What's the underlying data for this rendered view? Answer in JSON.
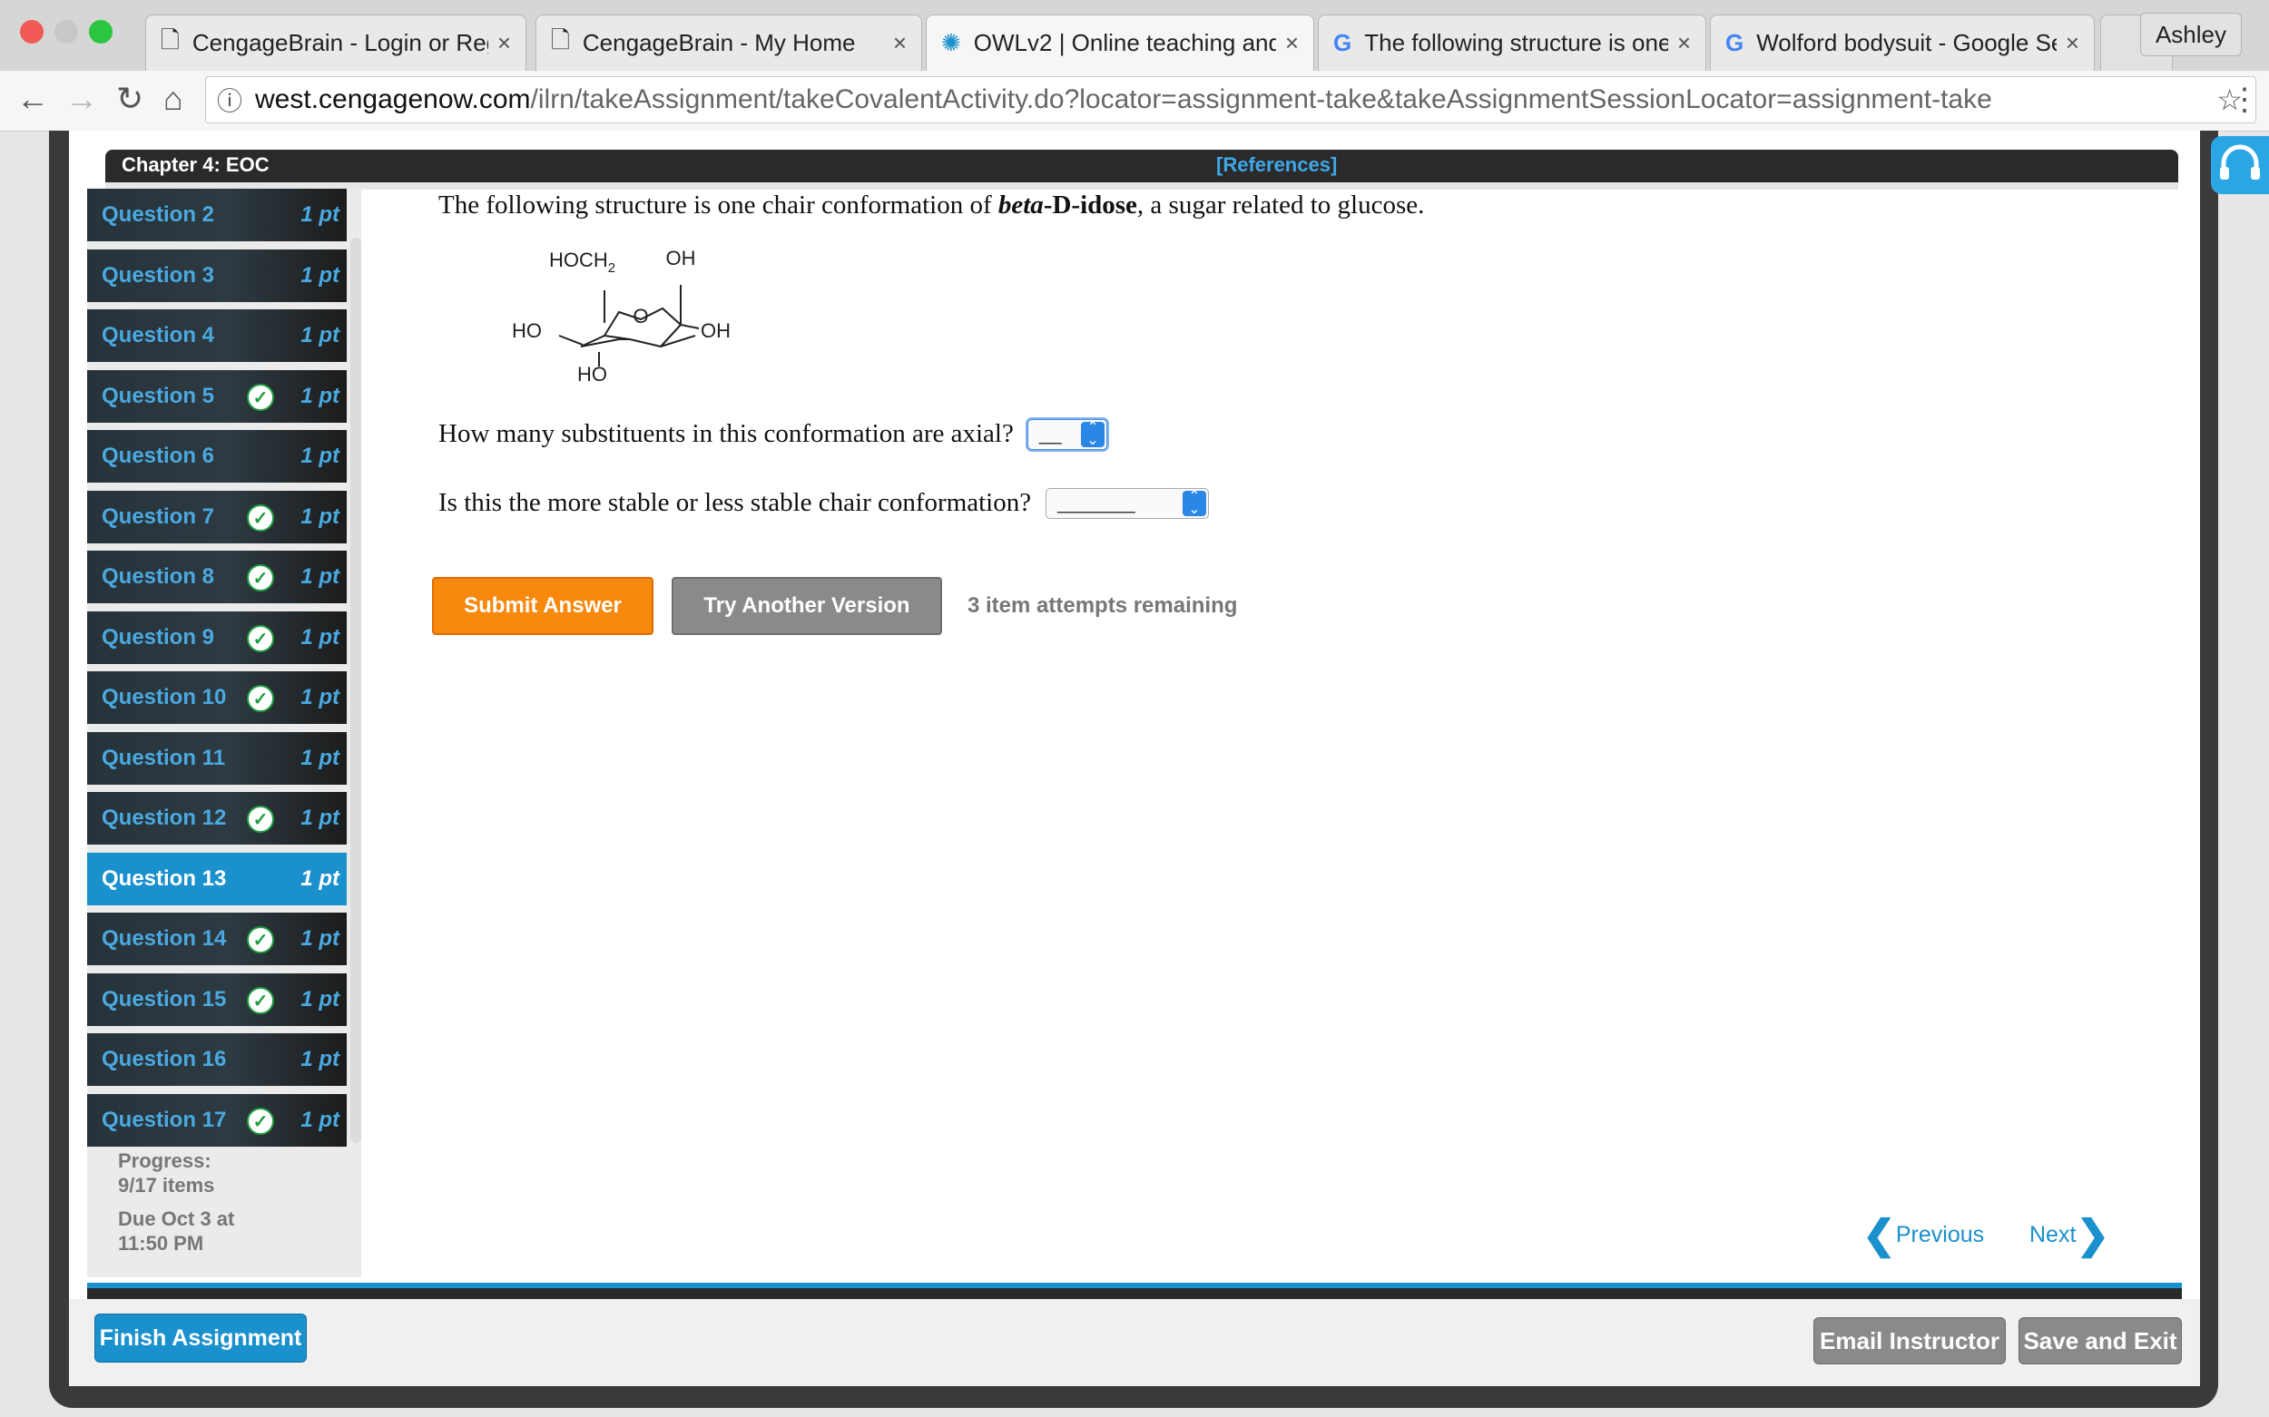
{
  "browser": {
    "tabs": [
      {
        "title": "CengageBrain - Login or Reg",
        "icon": "page-icon",
        "active": false
      },
      {
        "title": "CengageBrain - My Home",
        "icon": "page-icon",
        "active": false
      },
      {
        "title": "OWLv2 | Online teaching and",
        "icon": "owl-spinner-icon",
        "active": true
      },
      {
        "title": "The following structure is one",
        "icon": "google-icon",
        "active": false
      },
      {
        "title": "Wolford bodysuit - Google Se",
        "icon": "google-icon",
        "active": false
      }
    ],
    "profile": "Ashley",
    "url_domain": "west.cengagenow.com",
    "url_path": "/ilrn/takeAssignment/takeCovalentActivity.do?locator=assignment-take&takeAssignmentSessionLocator=assignment-take"
  },
  "assignment": {
    "chapter": "Chapter 4: EOC",
    "references": "[References]",
    "questions": [
      {
        "label": "Question 2",
        "pts": "1 pt",
        "done": false,
        "active": false
      },
      {
        "label": "Question 3",
        "pts": "1 pt",
        "done": false,
        "active": false
      },
      {
        "label": "Question 4",
        "pts": "1 pt",
        "done": false,
        "active": false
      },
      {
        "label": "Question 5",
        "pts": "1 pt",
        "done": true,
        "active": false
      },
      {
        "label": "Question 6",
        "pts": "1 pt",
        "done": false,
        "active": false
      },
      {
        "label": "Question 7",
        "pts": "1 pt",
        "done": true,
        "active": false
      },
      {
        "label": "Question 8",
        "pts": "1 pt",
        "done": true,
        "active": false
      },
      {
        "label": "Question 9",
        "pts": "1 pt",
        "done": true,
        "active": false
      },
      {
        "label": "Question 10",
        "pts": "1 pt",
        "done": true,
        "active": false
      },
      {
        "label": "Question 11",
        "pts": "1 pt",
        "done": false,
        "active": false
      },
      {
        "label": "Question 12",
        "pts": "1 pt",
        "done": true,
        "active": false
      },
      {
        "label": "Question 13",
        "pts": "1 pt",
        "done": false,
        "active": true
      },
      {
        "label": "Question 14",
        "pts": "1 pt",
        "done": true,
        "active": false
      },
      {
        "label": "Question 15",
        "pts": "1 pt",
        "done": true,
        "active": false
      },
      {
        "label": "Question 16",
        "pts": "1 pt",
        "done": false,
        "active": false
      },
      {
        "label": "Question 17",
        "pts": "1 pt",
        "done": true,
        "active": false
      }
    ],
    "progress_label": "Progress:",
    "progress_value": "9/17 items",
    "due_line1": "Due Oct 3 at",
    "due_line2": "11:50 PM"
  },
  "question": {
    "intro_before": "The following structure is one chair conformation of ",
    "intro_em": "beta",
    "intro_bold": "-D-idose",
    "intro_after": ", a sugar related to glucose.",
    "molecule_labels": {
      "hoch2": "HOCH",
      "sub2": "2",
      "oh_top": "OH",
      "ho_left": "HO",
      "oh_right": "OH",
      "ho_bottom": "HO",
      "ring_o": "O"
    },
    "q1": "How many substituents in this conformation are axial?",
    "q1_value": "__",
    "q2": "Is this the more stable or less stable chair conformation?",
    "q2_value": "_______"
  },
  "actions": {
    "submit": "Submit Answer",
    "try_another": "Try Another Version",
    "attempts": "3 item attempts remaining",
    "previous": "Previous",
    "next": "Next",
    "finish": "Finish Assignment",
    "email": "Email Instructor",
    "save_exit": "Save and Exit"
  },
  "colors": {
    "accent_blue": "#1a90cc",
    "submit_orange": "#f7890f",
    "check_green": "#1f9d41"
  }
}
